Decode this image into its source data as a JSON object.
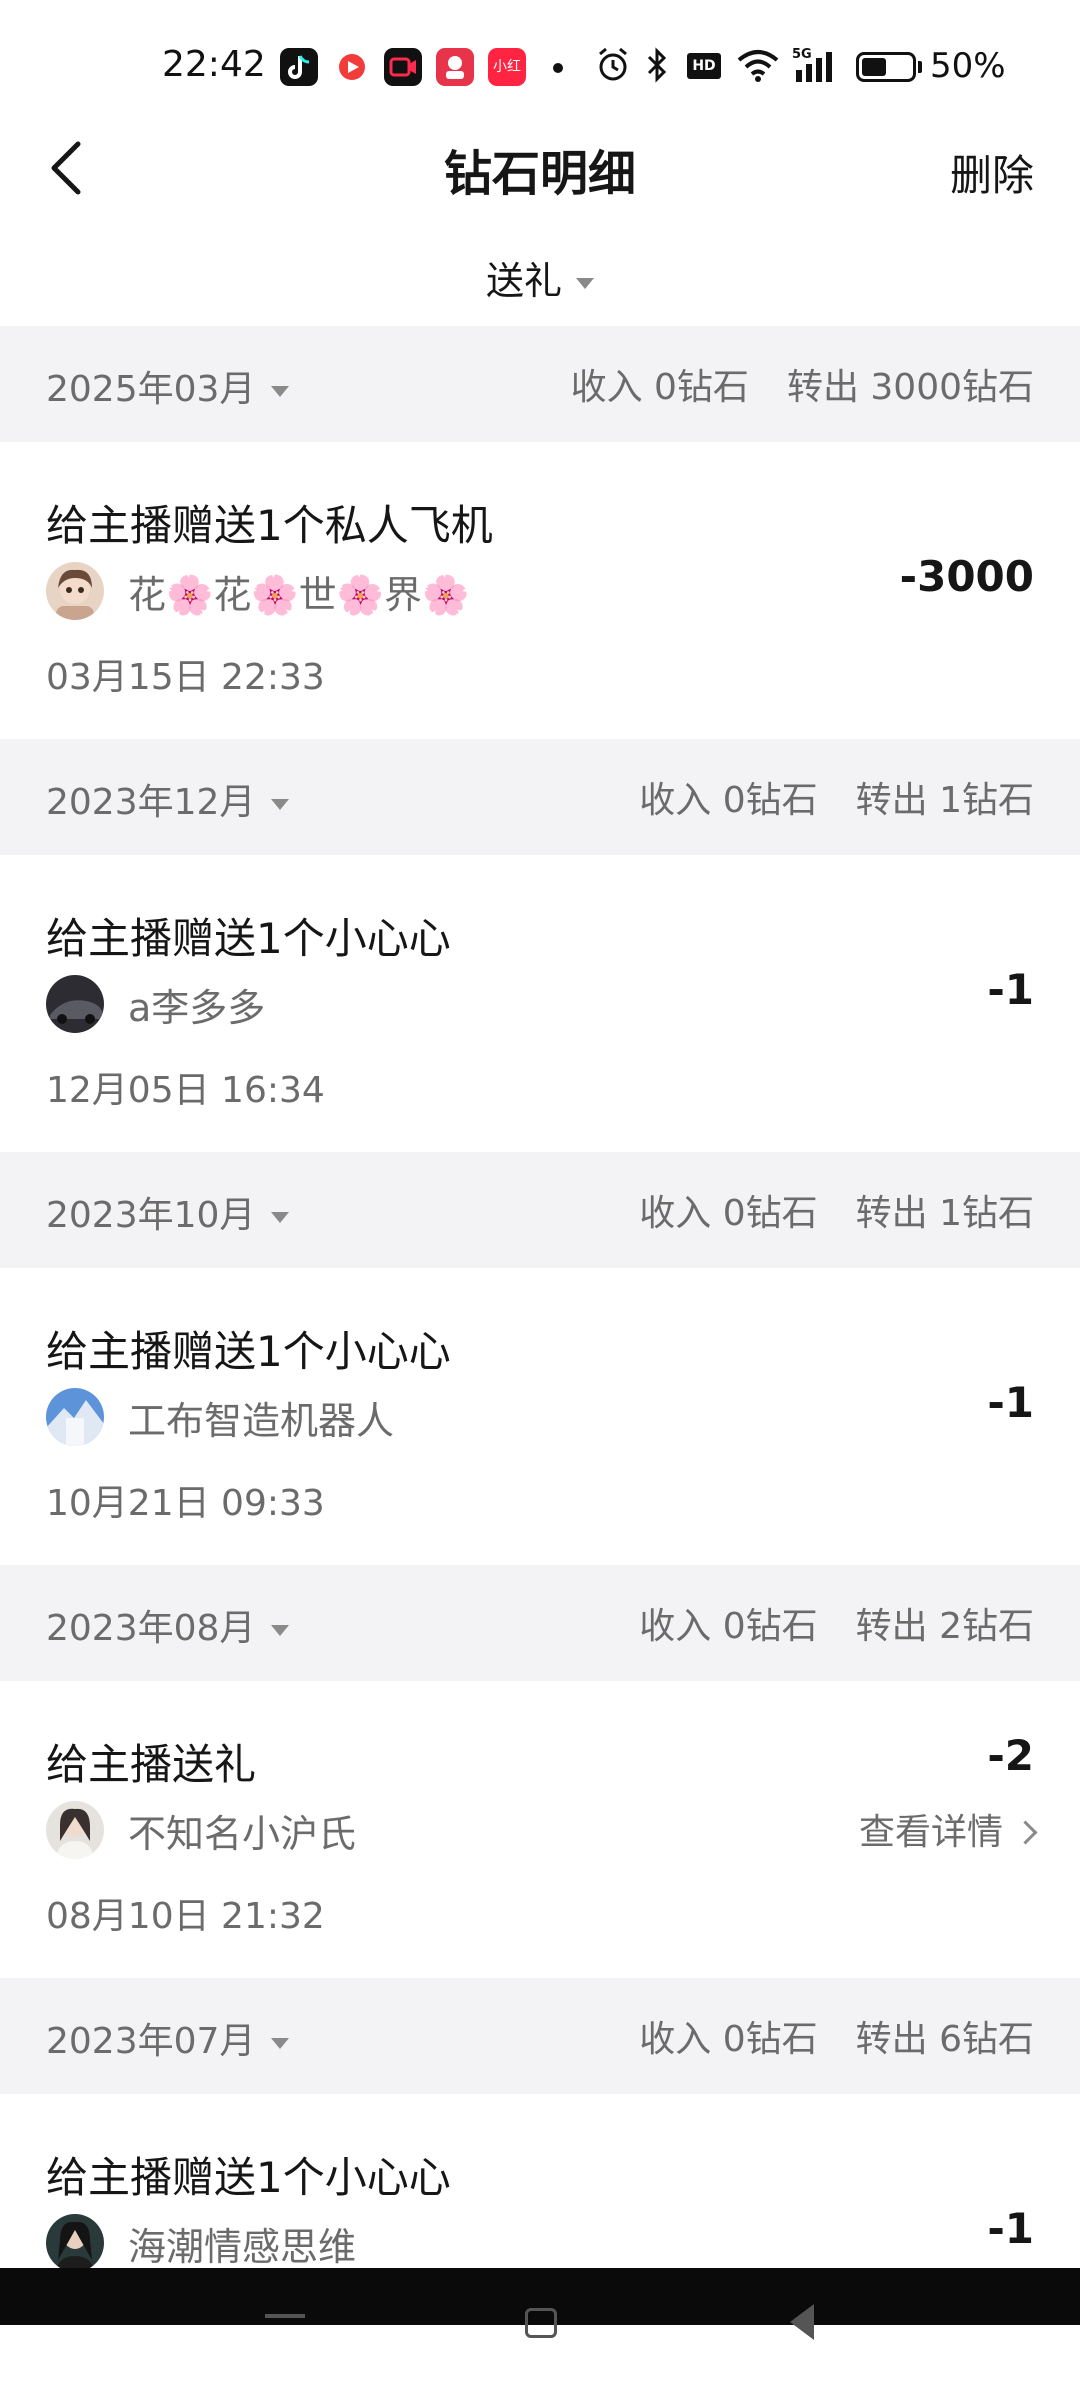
{
  "status_bar": {
    "time": "22:42",
    "battery_text": "50%",
    "battery_level": 0.5,
    "icons": [
      "tiktok-icon",
      "video-icon",
      "camera-icon",
      "app-icon",
      "xiaohongshu-icon",
      "dot-icon",
      "alarm-icon",
      "bluetooth-icon",
      "hd-icon",
      "wifi-icon",
      "signal-5g-icon",
      "battery-icon"
    ],
    "hd_label": "HD",
    "xhs_label": "小红书"
  },
  "header": {
    "title": "钻石明细",
    "delete_label": "删除",
    "filter_label": "送礼"
  },
  "months": [
    {
      "label": "2025年03月",
      "income": "收入 0钻石",
      "outflow": "转出 3000钻石",
      "entries": [
        {
          "title": "给主播赠送1个私人飞机",
          "anchor": "花🌸花🌸世🌸界🌸",
          "time": "03月15日 22:33",
          "amount": "-3000",
          "avatar_color": "#c9a48e"
        }
      ]
    },
    {
      "label": "2023年12月",
      "income": "收入 0钻石",
      "outflow": "转出 1钻石",
      "entries": [
        {
          "title": "给主播赠送1个小心心",
          "anchor": "a李多多",
          "time": "12月05日 16:34",
          "amount": "-1",
          "avatar_color": "#3c3c44"
        }
      ]
    },
    {
      "label": "2023年10月",
      "income": "收入 0钻石",
      "outflow": "转出 1钻石",
      "entries": [
        {
          "title": "给主播赠送1个小心心",
          "anchor": "工布智造机器人",
          "time": "10月21日 09:33",
          "amount": "-1",
          "avatar_color": "#4b7fc4"
        }
      ]
    },
    {
      "label": "2023年08月",
      "income": "收入 0钻石",
      "outflow": "转出 2钻石",
      "entries": [
        {
          "title": "给主播送礼",
          "anchor": "不知名小沪氏",
          "time": "08月10日 21:32",
          "amount": "-2",
          "detail_label": "查看详情",
          "avatar_color": "#d8d2cc"
        }
      ]
    },
    {
      "label": "2023年07月",
      "income": "收入 0钻石",
      "outflow": "转出 6钻石",
      "entries": [
        {
          "title": "给主播赠送1个小心心",
          "anchor": "海潮情感思维",
          "amount": "-1",
          "avatar_color": "#2a3a3a"
        }
      ]
    }
  ]
}
